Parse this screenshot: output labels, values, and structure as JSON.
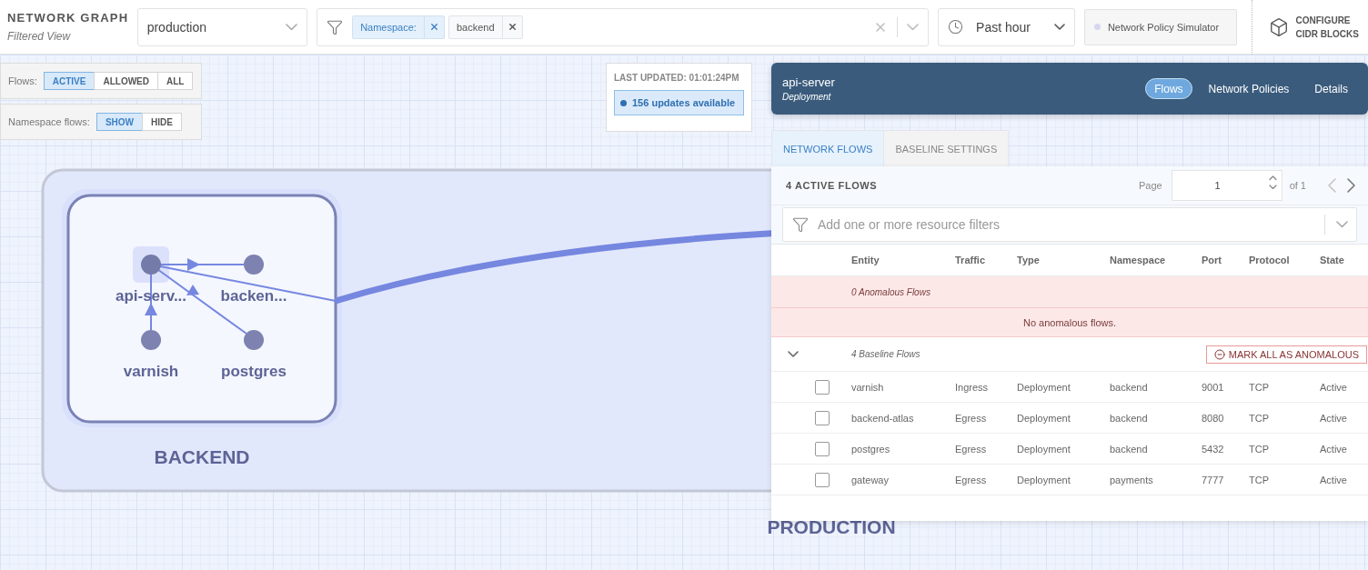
{
  "header": {
    "title": "NETWORK GRAPH",
    "subtitle": "Filtered View"
  },
  "cluster_select": {
    "value": "production"
  },
  "search_filter": {
    "chips": [
      {
        "label": "Namespace:",
        "kind": "key"
      },
      {
        "label": "backend",
        "kind": "value"
      }
    ]
  },
  "time_select": {
    "value": "Past hour"
  },
  "simulator_button": {
    "label": "Network Policy Simulator"
  },
  "cidr_button": {
    "label_lines": [
      "CONFIGURE",
      "CIDR BLOCKS"
    ]
  },
  "flows_toggle": {
    "label": "Flows:",
    "options": [
      {
        "label": "ACTIVE",
        "selected": true
      },
      {
        "label": "ALLOWED",
        "selected": false
      },
      {
        "label": "ALL",
        "selected": false
      }
    ]
  },
  "namespace_flows_toggle": {
    "label": "Namespace flows:",
    "options": [
      {
        "label": "SHOW",
        "selected": true
      },
      {
        "label": "HIDE",
        "selected": false
      }
    ]
  },
  "last_updated": {
    "label": "LAST UPDATED: 01:01:24PM",
    "updates_button": "156 updates available"
  },
  "graph": {
    "namespace_label": "PRODUCTION",
    "group_label": "BACKEND",
    "nodes": [
      {
        "label": "api-serv...",
        "selected": true
      },
      {
        "label": "backen...",
        "selected": false
      },
      {
        "label": "varnish",
        "selected": false
      },
      {
        "label": "postgres",
        "selected": false
      }
    ]
  },
  "side_panel": {
    "title": "api-server",
    "subtitle": "Deployment",
    "tabs": [
      {
        "label": "Flows",
        "selected": true
      },
      {
        "label": "Network Policies",
        "selected": false
      },
      {
        "label": "Details",
        "selected": false
      }
    ],
    "subtabs": [
      {
        "label": "NETWORK FLOWS",
        "selected": true
      },
      {
        "label": "BASELINE SETTINGS",
        "selected": false
      }
    ],
    "flows_count": "4 ACTIVE FLOWS",
    "pagination": {
      "label": "Page",
      "value": "1",
      "total": "of 1"
    },
    "filter": {
      "placeholder": "Add one or more resource filters"
    },
    "columns": [
      "Entity",
      "Traffic",
      "Type",
      "Namespace",
      "Port",
      "Protocol",
      "State"
    ],
    "anomalous": {
      "title": "0 Anomalous Flows",
      "empty": "No anomalous flows."
    },
    "baseline": {
      "title": "4 Baseline Flows",
      "expanded": true,
      "action": "MARK ALL AS ANOMALOUS",
      "rows": [
        {
          "checked": false,
          "cells": [
            "varnish",
            "Ingress",
            "Deployment",
            "backend",
            "9001",
            "TCP",
            "Active"
          ]
        },
        {
          "checked": false,
          "cells": [
            "backend-atlas",
            "Egress",
            "Deployment",
            "backend",
            "8080",
            "TCP",
            "Active"
          ]
        },
        {
          "checked": false,
          "cells": [
            "postgres",
            "Egress",
            "Deployment",
            "backend",
            "5432",
            "TCP",
            "Active"
          ]
        },
        {
          "checked": false,
          "cells": [
            "gateway",
            "Egress",
            "Deployment",
            "payments",
            "7777",
            "TCP",
            "Active"
          ]
        }
      ]
    }
  }
}
